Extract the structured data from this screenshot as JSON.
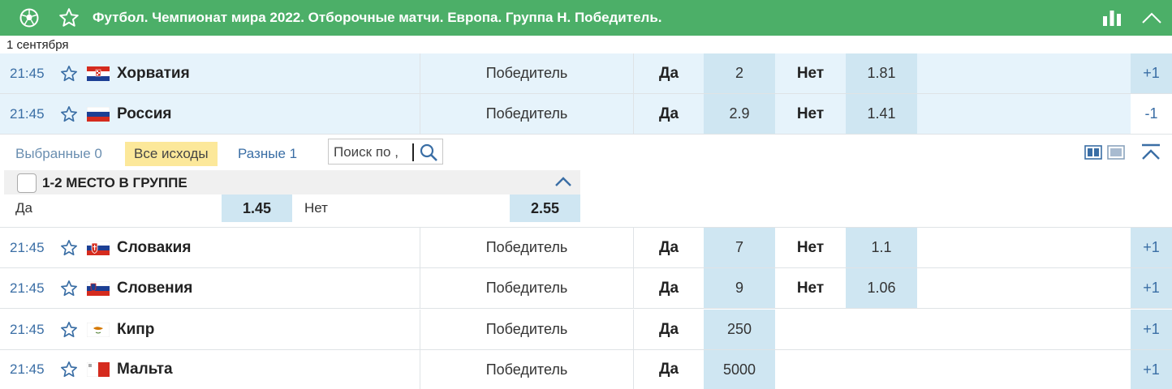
{
  "header": {
    "title": "Футбол. Чемпионат мира 2022. Отборочные матчи. Европа. Группа H. Победитель.",
    "icons": [
      "soccer-ball-icon",
      "star-icon",
      "stats-icon",
      "chevron-up-icon"
    ],
    "accent": "#4caf68"
  },
  "date_label": "1 сентября",
  "rows_top": [
    {
      "time": "21:45",
      "team": "Хорватия",
      "flag": "croatia",
      "bet": "Победитель",
      "yes_label": "Да",
      "yes_odd": "2",
      "no_label": "Нет",
      "no_odd": "1.81",
      "more": "+1"
    },
    {
      "time": "21:45",
      "team": "Россия",
      "flag": "russia",
      "bet": "Победитель",
      "yes_label": "Да",
      "yes_odd": "2.9",
      "no_label": "Нет",
      "no_odd": "1.41",
      "more": "-1"
    }
  ],
  "filters": {
    "selected": "Выбранные 0",
    "all": "Все исходы",
    "diff": "Разные 1",
    "search_placeholder": "Поиск по ,"
  },
  "market": {
    "title": "1-2 МЕСТО В ГРУППЕ",
    "yes_label": "Да",
    "yes_odd": "1.45",
    "no_label": "Нет",
    "no_odd": "2.55"
  },
  "rows_bottom": [
    {
      "time": "21:45",
      "team": "Словакия",
      "flag": "slovakia",
      "bet": "Победитель",
      "yes_label": "Да",
      "yes_odd": "7",
      "no_label": "Нет",
      "no_odd": "1.1",
      "more": "+1"
    },
    {
      "time": "21:45",
      "team": "Словения",
      "flag": "slovenia",
      "bet": "Победитель",
      "yes_label": "Да",
      "yes_odd": "9",
      "no_label": "Нет",
      "no_odd": "1.06",
      "more": "+1"
    },
    {
      "time": "21:45",
      "team": "Кипр",
      "flag": "cyprus",
      "bet": "Победитель",
      "yes_label": "Да",
      "yes_odd": "250",
      "no_label": "",
      "no_odd": "",
      "more": "+1"
    },
    {
      "time": "21:45",
      "team": "Мальта",
      "flag": "malta",
      "bet": "Победитель",
      "yes_label": "Да",
      "yes_odd": "5000",
      "no_label": "",
      "no_odd": "",
      "more": "+1"
    }
  ]
}
